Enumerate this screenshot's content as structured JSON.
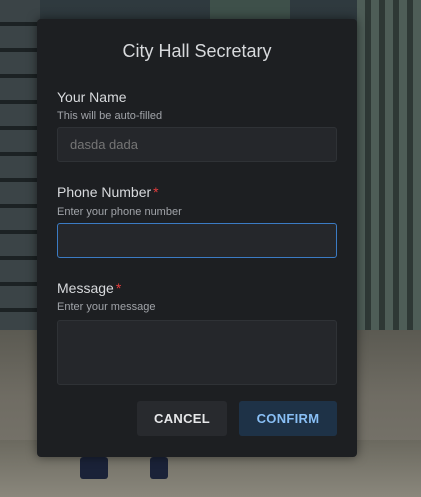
{
  "dialog": {
    "title": "City Hall Secretary",
    "name_field": {
      "label": "Your Name",
      "description": "This will be auto-filled",
      "placeholder": "dasda dada"
    },
    "phone_field": {
      "label": "Phone Number",
      "required_marker": "*",
      "description": "Enter your phone number",
      "value": ""
    },
    "message_field": {
      "label": "Message",
      "required_marker": "*",
      "description": "Enter your message",
      "value": ""
    },
    "buttons": {
      "cancel_label": "CANCEL",
      "confirm_label": "CONFIRM"
    }
  },
  "colors": {
    "modal_background": "#1d1f22",
    "required_marker": "#e53d3d",
    "focus_border": "#3b7bc4",
    "confirm_text": "#89bff5",
    "confirm_background": "#1e3247"
  }
}
